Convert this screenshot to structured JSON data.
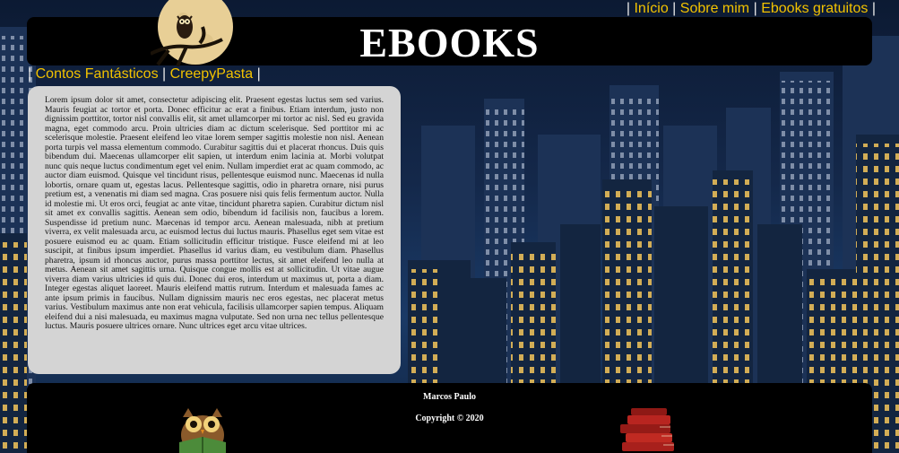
{
  "nav": {
    "top_links": [
      "Início",
      "Sobre mim",
      "Ebooks gratuitos"
    ],
    "category_links": [
      "Contos Fantásticos",
      "CreepyPasta"
    ]
  },
  "header": {
    "title": "EBOOKS"
  },
  "article": {
    "text": "Lorem ipsum dolor sit amet, consectetur adipiscing elit. Praesent egestas luctus sem sed varius. Mauris feugiat ac tortor et porta. Donec efficitur ac erat a finibus. Etiam interdum, justo non dignissim porttitor, tortor nisl convallis elit, sit amet ullamcorper mi tortor ac nisl. Sed eu gravida magna, eget commodo arcu. Proin ultricies diam ac dictum scelerisque. Sed porttitor mi ac scelerisque molestie. Praesent eleifend leo vitae lorem semper sagittis molestie non nisl. Aenean porta turpis vel massa elementum commodo. Curabitur sagittis dui et placerat rhoncus. Duis quis bibendum dui. Maecenas ullamcorper elit sapien, ut interdum enim lacinia at. Morbi volutpat nunc quis neque luctus condimentum eget vel enim. Nullam imperdiet erat ac quam commodo, ac auctor diam euismod. Quisque vel tincidunt risus, pellentesque euismod nunc. Maecenas id nulla lobortis, ornare quam ut, egestas lacus. Pellentesque sagittis, odio in pharetra ornare, nisi purus pretium est, a venenatis mi diam sed magna. Cras posuere nisi quis felis fermentum auctor. Nulla id molestie mi. Ut eros orci, feugiat ac ante vitae, tincidunt pharetra sapien. Curabitur dictum nisl sit amet ex convallis sagittis. Aenean sem odio, bibendum id facilisis non, faucibus a lorem. Suspendisse id pretium nunc. Maecenas id tempor arcu. Aenean malesuada, nibh at pretium viverra, ex velit malesuada arcu, ac euismod lectus dui luctus mauris. Phasellus eget sem vitae est posuere euismod eu ac quam. Etiam sollicitudin efficitur tristique. Fusce eleifend mi at leo suscipit, at finibus ipsum imperdiet. Phasellus id varius diam, eu vestibulum diam. Phasellus pharetra, ipsum id rhoncus auctor, purus massa porttitor lectus, sit amet eleifend leo nulla at metus. Aenean sit amet sagittis urna. Quisque congue mollis est at sollicitudin. Ut vitae augue viverra diam varius ultricies id quis dui. Donec dui eros, interdum ut maximus ut, porta a diam. Integer egestas aliquet laoreet. Mauris eleifend mattis rutrum. Interdum et malesuada fames ac ante ipsum primis in faucibus. Nullam dignissim mauris nec eros egestas, nec placerat metus varius. Vestibulum maximus ante non erat vehicula, facilisis ullamcorper sapien tempus. Aliquam eleifend dui a nisi malesuada, eu maximus magna vulputate. Sed non urna nec tellus pellentesque luctus. Mauris posuere ultrices ornare. Nunc ultrices eget arcu vitae ultrices."
  },
  "footer": {
    "author": "Marcos Paulo",
    "copyright": "Copyright © 2020"
  },
  "icons": {
    "header_logo": "owl-moon-icon",
    "footer_left": "owl-reading-icon",
    "footer_right": "books-stack-icon"
  },
  "colors": {
    "link": "#f2c200",
    "panel": "#000000",
    "article_bg": "#d4d4d4"
  }
}
